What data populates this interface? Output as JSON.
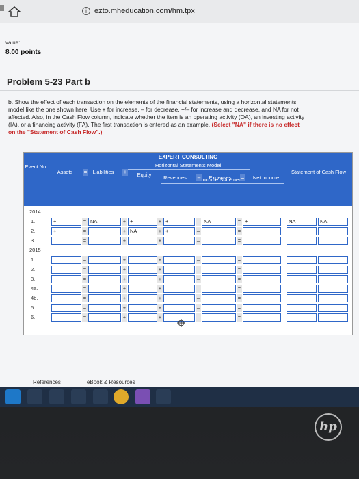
{
  "browser": {
    "url": "ezto.mheducation.com/hm.tpx"
  },
  "header": {
    "value_label": "value:",
    "points": "8.00 points"
  },
  "problem": {
    "title": "Problem 5-23 Part b",
    "instructions": "b. Show the effect of each transaction on the elements of the financial statements, using a horizontal statements model like the one shown here. Use + for increase, – for decrease, +/– for increase and decrease, and NA for not affected. Also, in the Cash Flow column, indicate whether the item is an operating activity (OA), an investing activity (IA), or a financing activity (FA). The first transaction is entered as an example.",
    "instructions_highlight": "(Select \"NA\" if there is no effect on the \"Statement of Cash Flow\".)"
  },
  "table": {
    "company": "EXPERT CONSULTING",
    "model_title": "Horizontal Statements Model",
    "income_statement": "Income Statement",
    "headers": {
      "event_no": "Event No.",
      "assets": "Assets",
      "liabilities": "Liabilities",
      "equity": "Equity",
      "revenues": "Revenues",
      "expenses": "Expenses",
      "net_income": "Net Income",
      "cash_flow": "Statement of Cash Flow"
    },
    "ops": {
      "eq1": "=",
      "plus1": "+",
      "minus": "–",
      "eq2": "="
    },
    "years": [
      "2014",
      "2015"
    ],
    "rows_2014": [
      {
        "event": "1.",
        "assets": "+",
        "liab": "NA",
        "equity": "+",
        "revenues": "+",
        "expenses": "NA",
        "net_income": "+",
        "cf1": "NA",
        "cf2": "NA"
      },
      {
        "event": "2.",
        "assets": "+",
        "liab": "",
        "equity": "NA",
        "revenues": "+",
        "expenses": "",
        "net_income": "",
        "cf1": "",
        "cf2": ""
      },
      {
        "event": "3.",
        "assets": "",
        "liab": "",
        "equity": "",
        "revenues": "",
        "expenses": "",
        "net_income": "",
        "cf1": "",
        "cf2": ""
      }
    ],
    "rows_2015": [
      {
        "event": "1."
      },
      {
        "event": "2."
      },
      {
        "event": "3."
      },
      {
        "event": "4a."
      },
      {
        "event": "4b."
      },
      {
        "event": "5."
      },
      {
        "event": "6."
      }
    ]
  },
  "footer": {
    "references": "References",
    "ebook": "eBook & Resources"
  },
  "brand": {
    "laptop_logo": "hp"
  }
}
